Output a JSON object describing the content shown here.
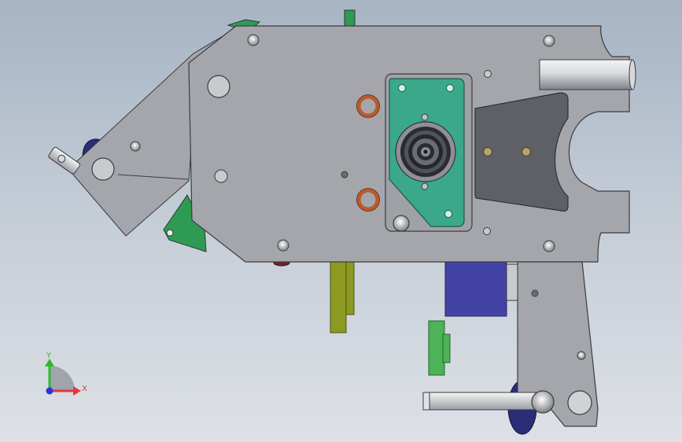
{
  "viewport": {
    "background_top": "#a6b4c4",
    "background_bottom": "#dde1e6"
  },
  "colors": {
    "plate": "#a4a6ab",
    "plate_shade": "#9a9ca1",
    "outline": "#3a3c40",
    "teal_bracket": "#3aa889",
    "green_part": "#2f9a54",
    "bright_green": "#4cb356",
    "olive_bar": "#8c9a22",
    "blue_block": "#4343a5",
    "navy_wheel": "#2a2d78",
    "dark_insert": "#5e6065",
    "copper_ring": "#b85a2c",
    "brass_bolt": "#b4a270",
    "cylinder_light": "#e8e9eb",
    "cylinder_dark": "#8c8f94"
  },
  "triad": {
    "x_label": "X",
    "y_label": "Y",
    "x_color": "#e23a3a",
    "y_color": "#2cba2c",
    "z_color": "#2a36d8",
    "arc_color": "#8e929a"
  }
}
